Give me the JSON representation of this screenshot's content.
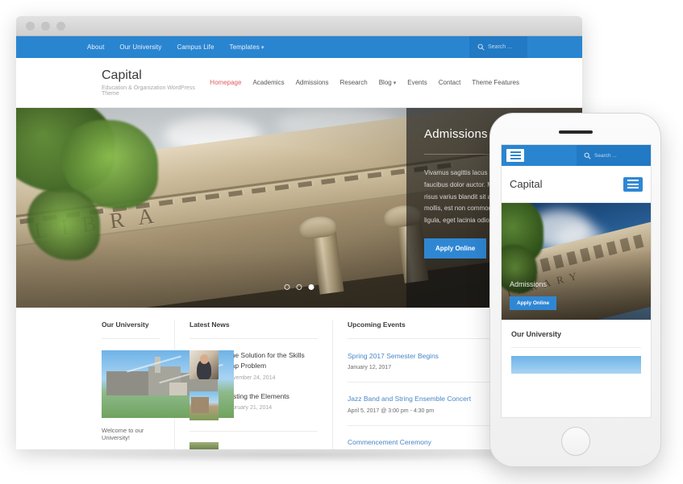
{
  "browser": {
    "topbar": {
      "nav_items": [
        {
          "label": "About",
          "has_caret": false
        },
        {
          "label": "Our University",
          "has_caret": false
        },
        {
          "label": "Campus Life",
          "has_caret": false
        },
        {
          "label": "Templates",
          "has_caret": true
        }
      ],
      "search_placeholder": "Search ...",
      "search_icon": "magnifier-icon",
      "bar_color": "#2a85d0",
      "search_bg_color": "#2279c4"
    },
    "header": {
      "brand_title": "Capital",
      "brand_tagline": "Education & Organization WordPress Theme",
      "nav_items": [
        {
          "label": "Homepage",
          "active": true,
          "has_caret": false
        },
        {
          "label": "Academics",
          "active": false,
          "has_caret": false
        },
        {
          "label": "Admissions",
          "active": false,
          "has_caret": false
        },
        {
          "label": "Research",
          "active": false,
          "has_caret": false
        },
        {
          "label": "Blog",
          "active": false,
          "has_caret": true
        },
        {
          "label": "Events",
          "active": false,
          "has_caret": false
        },
        {
          "label": "Contact",
          "active": false,
          "has_caret": false
        },
        {
          "label": "Theme Features",
          "active": false,
          "has_caret": false
        }
      ],
      "active_color": "#e05c5c"
    },
    "hero": {
      "title": "Admissions",
      "body": "Vivamus sagittis lacus vel augue laoreet rutrum faucibus dolor auctor. Maecenas sed diam eget risus varius blandit sit amet non magna. Duis mollis, est non commodo luctus, nisi erat porttitor ligula, eget lacinia odio sem nec elit.",
      "button_label": "Apply Online",
      "button_color": "#2f87d4",
      "slide_count": 3,
      "active_slide": 3,
      "image_inscription": "LIBRA"
    },
    "our_university": {
      "title": "Our University",
      "caption": "Welcome to our University!"
    },
    "latest_news": {
      "title": "Latest News",
      "items": [
        {
          "title": "One Solution for the Skills Gap Problem",
          "date": "November 24, 2014"
        },
        {
          "title": "Testing the Elements",
          "date": "February 21, 2014"
        },
        {
          "title": "",
          "date": ""
        }
      ]
    },
    "upcoming_events": {
      "title": "Upcoming Events",
      "link_color": "#4a86c8",
      "items": [
        {
          "title": "Spring 2017 Semester Begins",
          "date": "January 12, 2017"
        },
        {
          "title": "Jazz Band and String Ensemble Concert",
          "date": "April 5, 2017 @ 3:00 pm - 4:30 pm"
        },
        {
          "title": "Commencement Ceremony",
          "date": ""
        }
      ]
    }
  },
  "phone": {
    "topbar": {
      "menu_icon": "hamburger-icon",
      "search_icon": "magnifier-icon",
      "search_placeholder": "Search ..."
    },
    "header": {
      "brand_title": "Capital",
      "menu_icon": "hamburger-icon"
    },
    "hero": {
      "title": "Admissions",
      "button_label": "Apply Online",
      "image_inscription": "LIBRARY"
    },
    "section": {
      "title": "Our University"
    },
    "home_button": "home-button"
  }
}
